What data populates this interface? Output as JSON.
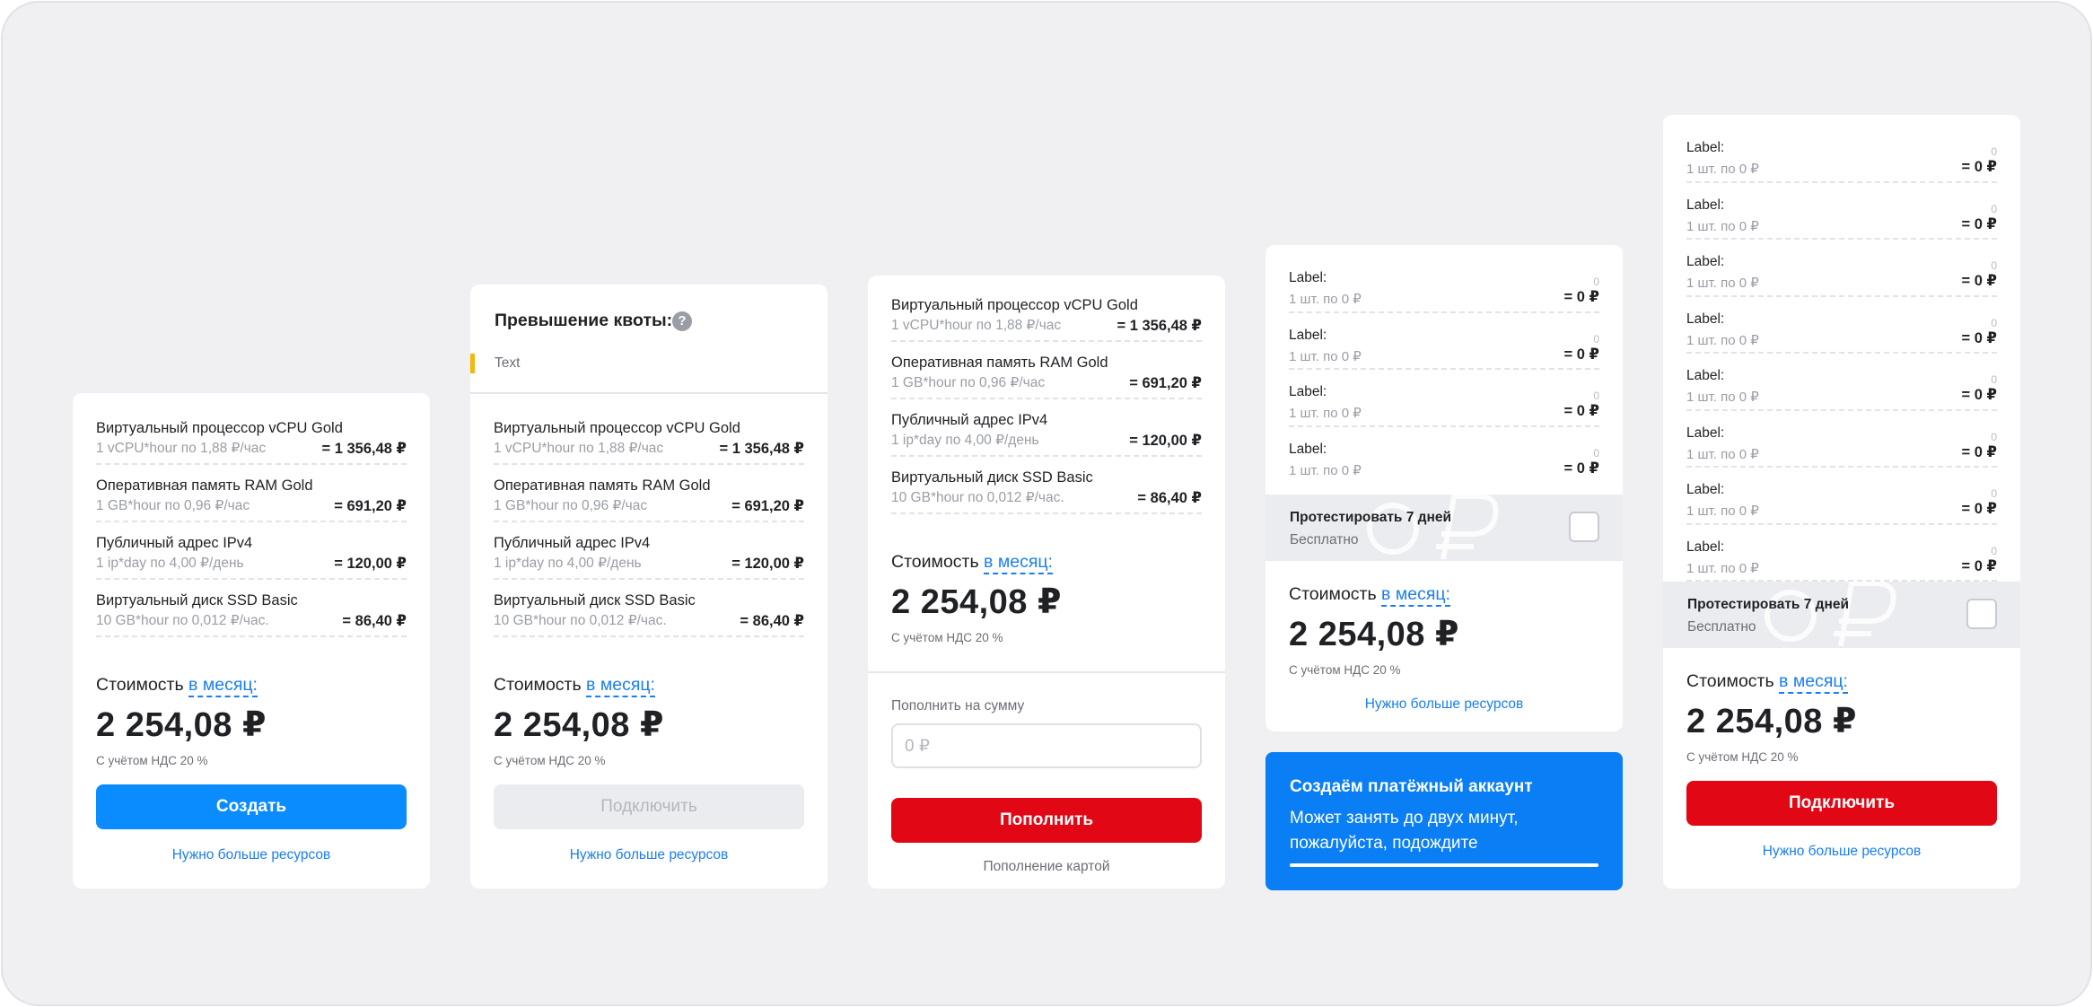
{
  "resources": [
    {
      "name": "Виртуальный процессор vCPU Gold",
      "sub": "1 vCPU*hour по 1,88 ₽/час",
      "price": "= 1 356,48 ₽"
    },
    {
      "name": "Оперативная память RAM Gold",
      "sub": "1 GB*hour по 0,96 ₽/час",
      "price": "= 691,20 ₽"
    },
    {
      "name": "Публичный адрес IPv4",
      "sub": "1 ip*day по 4,00 ₽/день",
      "price": "= 120,00 ₽"
    },
    {
      "name": "Виртуальный диск SSD Basic",
      "sub": "10 GB*hour по 0,012 ₽/час.",
      "price": "= 86,40 ₽"
    }
  ],
  "cost": {
    "label": "Стоимость",
    "period_link": "в месяц:",
    "amount": "2 254,08 ₽",
    "vat_note": "С учётом НДС 20 %"
  },
  "more_resources_link": "Нужно больше ресурсов",
  "card1": {
    "button": "Создать"
  },
  "card2": {
    "quota_title": "Превышение квоты:",
    "quota_help": "?",
    "quota_text": "Text",
    "button": "Подключить"
  },
  "card3": {
    "topup_label": "Пополнить на сумму",
    "topup_placeholder": "0 ₽",
    "button": "Пополнить",
    "note": "Пополнение картой"
  },
  "label_item": {
    "label": "Label:",
    "qty": "0",
    "sub": "1 шт. по 0 ₽",
    "price": "= 0 ₽"
  },
  "trial": {
    "title": "Протестировать 7 дней",
    "sub": "Бесплатно"
  },
  "card4": {
    "label_rows": 4
  },
  "banner": {
    "title": "Создаём платёжный аккаунт",
    "text": "Может занять до двух минут, пожалуйста, подождите",
    "progress": 1.0
  },
  "card5": {
    "label_rows": 8,
    "button": "Подключить"
  },
  "colors": {
    "accent_blue": "#0a8cff",
    "accent_red": "#e20714",
    "link_blue": "#1a7ef2",
    "quota_yellow": "#f5b70a"
  }
}
